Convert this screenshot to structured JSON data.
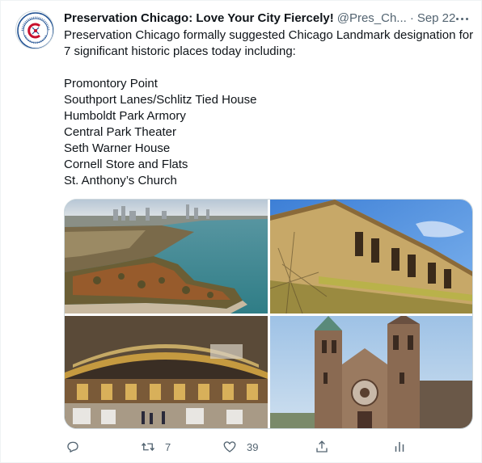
{
  "tweet": {
    "author_name": "Preservation Chicago: Love Your City Fiercely!",
    "handle": "@Pres_Ch...",
    "separator": "·",
    "date": "Sep 22",
    "avatar_lines": [
      "PRESERVATION",
      "CHICAGO"
    ],
    "intro": "Preservation Chicago formally suggested Chicago Landmark designation for 7 significant historic places today including:",
    "places": [
      "Promontory Point",
      "Southport Lanes/Schlitz Tied House",
      "Humboldt Park Armory",
      "Central Park Theater",
      "Seth Warner House",
      "Cornell Store and Flats",
      "St. Anthony’s Church"
    ]
  },
  "media": {
    "images": [
      {
        "icon": "aerial-lakefront-photo"
      },
      {
        "icon": "armory-building-photo"
      },
      {
        "icon": "theater-interior-photo"
      },
      {
        "icon": "church-towers-photo"
      }
    ]
  },
  "actions": {
    "reply_icon": "reply-icon",
    "retweet_count": "7",
    "like_count": "39",
    "share_icon": "share-icon",
    "analytics_icon": "analytics-icon"
  },
  "colors": {
    "text": "#0f1419",
    "secondary": "#536471",
    "border": "#cfd9de",
    "logo_red": "#c8102e",
    "logo_blue": "#1d4f91"
  }
}
